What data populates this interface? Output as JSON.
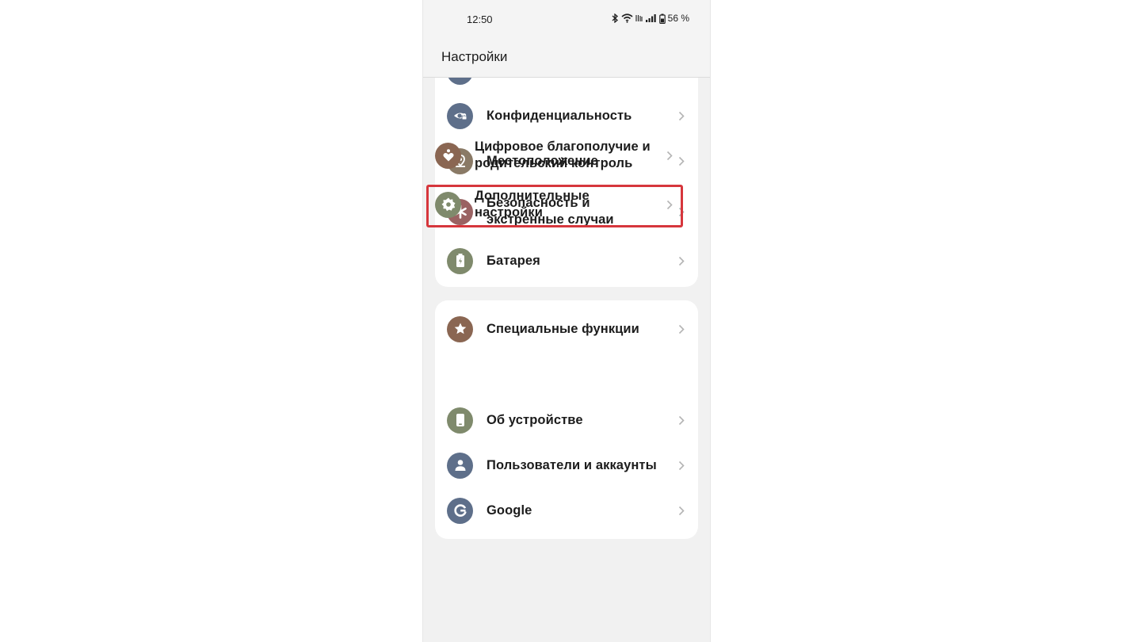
{
  "status_bar": {
    "time": "12:50",
    "battery": "56 %"
  },
  "app_bar": {
    "title": "Настройки"
  },
  "groups": [
    {
      "items": [
        {
          "label": "Конфиденциальность",
          "icon": "privacy-eye-lock-icon",
          "color": "#5e6f8a"
        },
        {
          "label": "Местоположение",
          "icon": "location-pin-icon",
          "color": "#8a7a66"
        },
        {
          "label": "Безопасность и экстренные случаи",
          "icon": "emergency-asterisk-icon",
          "color": "#9a6262"
        },
        {
          "label": "Батарея",
          "icon": "battery-icon",
          "color": "#7f8a6c"
        }
      ]
    },
    {
      "items": [
        {
          "label": "Специальные функции",
          "icon": "accessibility-star-icon",
          "color": "#8a6652"
        },
        {
          "label": "Цифровое благополучие и родительский контроль",
          "icon": "wellbeing-heart-icon",
          "color": "#8a6652"
        },
        {
          "label": "Дополнительные настройки",
          "icon": "gear-icon",
          "color": "#7f8a6c",
          "highlighted": true
        }
      ]
    },
    {
      "items": [
        {
          "label": "Об устройстве",
          "icon": "device-phone-icon",
          "color": "#7f8a6c"
        },
        {
          "label": "Пользователи и аккаунты",
          "icon": "user-account-icon",
          "color": "#5e6f8a"
        },
        {
          "label": "Google",
          "icon": "google-g-icon",
          "color": "#5e6f8a"
        }
      ]
    }
  ],
  "colors": {
    "highlight": "#d6363c",
    "chevron": "#b4b4b4"
  }
}
